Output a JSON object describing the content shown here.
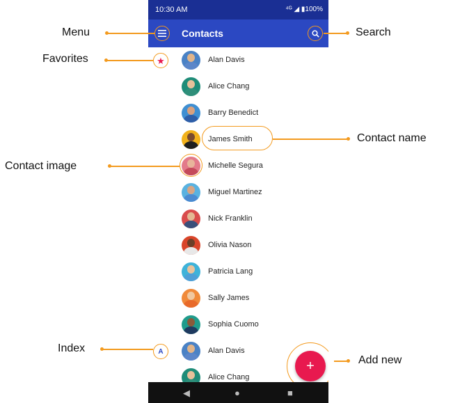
{
  "status": {
    "time": "10:30 AM",
    "icons": "⁴ᴳ ◢ ▮100%"
  },
  "appbar": {
    "title": "Contacts",
    "menu_icon": "hamburger-icon",
    "search_icon": "search-icon"
  },
  "favorites_icon": "star-icon",
  "index_letter": "A",
  "contacts": [
    {
      "name": "Alan Davis",
      "skin": "#e0b48a",
      "shirt": "#5b86c9",
      "bg": "#4a82c5"
    },
    {
      "name": "Alice Chang",
      "skin": "#e7c09a",
      "shirt": "#2f8f7a",
      "bg": "#1e8c78"
    },
    {
      "name": "Barry Benedict",
      "skin": "#d9a17e",
      "shirt": "#2e5ea8",
      "bg": "#3f8fd2"
    },
    {
      "name": "James Smith",
      "skin": "#7a4b2e",
      "shirt": "#1f1f1f",
      "bg": "#f2b21c"
    },
    {
      "name": "Michelle Segura",
      "skin": "#e8b59b",
      "shirt": "#c44a5a",
      "bg": "#e37a8a"
    },
    {
      "name": "Miguel Martinez",
      "skin": "#d7a584",
      "shirt": "#4b8bd1",
      "bg": "#5ab2e0"
    },
    {
      "name": "Nick Franklin",
      "skin": "#e4b893",
      "shirt": "#3a4f7a",
      "bg": "#d94c4c"
    },
    {
      "name": "Olivia Nason",
      "skin": "#6b3f28",
      "shirt": "#e8e8e8",
      "bg": "#d9452a"
    },
    {
      "name": "Patricia Lang",
      "skin": "#e9c39c",
      "shirt": "#4f9fd6",
      "bg": "#3fb3d9"
    },
    {
      "name": "Sally James",
      "skin": "#f0c8a0",
      "shirt": "#e86a2a",
      "bg": "#f08a3a"
    },
    {
      "name": "Sophia Cuomo",
      "skin": "#8a5a3a",
      "shirt": "#1e3a5f",
      "bg": "#1f9c8c"
    },
    {
      "name": "Alan Davis",
      "skin": "#e0b48a",
      "shirt": "#5b86c9",
      "bg": "#4a82c5"
    },
    {
      "name": "Alice Chang",
      "skin": "#e7c09a",
      "shirt": "#2f8f7a",
      "bg": "#1e8c78"
    }
  ],
  "fab": {
    "symbol": "+"
  },
  "navbar": {
    "back": "◀",
    "home": "●",
    "recents": "■"
  },
  "callouts": {
    "menu": "Menu",
    "favorites": "Favorites",
    "contact_image": "Contact image",
    "index": "Index",
    "search": "Search",
    "contact_name": "Contact name",
    "add_new": "Add new"
  },
  "colors": {
    "accent": "#f39a1e",
    "appbar": "#2b48c2",
    "statusbar": "#1a2f94",
    "fab": "#e8194f"
  }
}
